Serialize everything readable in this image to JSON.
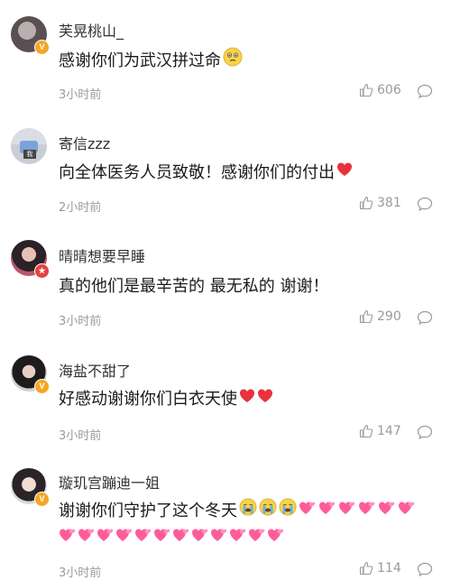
{
  "comments": [
    {
      "username": "芙晃桃山_",
      "text": "感谢你们为武汉拼过命",
      "time": "3小时前",
      "likes": "606",
      "badge": "V",
      "emojis": [
        "teary-face-emoji"
      ]
    },
    {
      "username": "寄信zzz",
      "text": "向全体医务人员致敬！感谢你们的付出",
      "time": "2小时前",
      "likes": "381",
      "badge": "",
      "emojis": [
        "red-heart-emoji"
      ]
    },
    {
      "username": "晴晴想要早睡",
      "text": "真的他们是最辛苦的 最无私的 谢谢！",
      "time": "3小时前",
      "likes": "290",
      "badge": "★",
      "emojis": []
    },
    {
      "username": "海盐不甜了",
      "text": "好感动谢谢你们白衣天使",
      "time": "3小时前",
      "likes": "147",
      "badge": "V",
      "emojis": [
        "red-heart-emoji",
        "red-heart-emoji"
      ]
    },
    {
      "username": "璇玑宫蹦迪一姐",
      "text": "谢谢你们守护了这个冬天",
      "time": "3小时前",
      "likes": "114",
      "badge": "V",
      "emojis": [
        "crying-face-emoji x3",
        "pink-hearts-emoji x6 then x12"
      ]
    }
  ],
  "colors": {
    "text": "#1a1a1a",
    "meta": "#9a9a9a",
    "heart": "#e8323c",
    "pink_heart": "#ff5c9a",
    "badge_orange": "#f5a623"
  }
}
